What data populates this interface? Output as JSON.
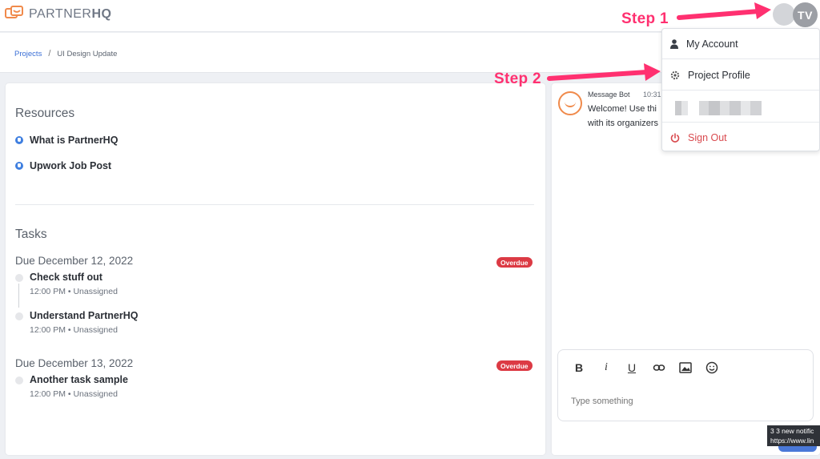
{
  "app": {
    "logo_text": "PARTNERHQ",
    "logo_plain": "PARTNER",
    "logo_bold": "HQ"
  },
  "user": {
    "initials": "TV"
  },
  "breadcrumb": {
    "root": "Projects",
    "separator": "/",
    "current": "UI Design Update"
  },
  "resources": {
    "title": "Resources",
    "items": [
      {
        "label": "What is PartnerHQ"
      },
      {
        "label": "Upwork Job Post"
      }
    ]
  },
  "tasks": {
    "title": "Tasks",
    "groups": [
      {
        "due": "Due December 12, 2022",
        "badge": "Overdue",
        "items": [
          {
            "name": "Check stuff out",
            "meta": "12:00 PM • Unassigned"
          },
          {
            "name": "Understand PartnerHQ",
            "meta": "12:00 PM • Unassigned"
          }
        ]
      },
      {
        "due": "Due December 13, 2022",
        "badge": "Overdue",
        "items": [
          {
            "name": "Another task sample",
            "meta": "12:00 PM • Unassigned"
          }
        ]
      }
    ]
  },
  "chat": {
    "sender": "Message Bot",
    "time": "10:31",
    "message_line1": "Welcome! Use thi",
    "message_line2": "with its organizers",
    "composer": {
      "placeholder": "Type something",
      "tools": [
        "B",
        "i",
        "U"
      ]
    }
  },
  "dropdown": {
    "items": [
      {
        "label": "My Account",
        "icon": "person-icon"
      },
      {
        "label": "Project Profile",
        "icon": "gear-icon"
      },
      {
        "label": "",
        "icon": "blurred-email"
      },
      {
        "label": "Sign Out",
        "icon": "power-icon"
      }
    ]
  },
  "annotations": {
    "step1": "Step 1",
    "step2": "Step 2",
    "color": "#ff3070"
  },
  "tooltip": {
    "line1": "3 3 new notific",
    "line2": "https://www.lin"
  },
  "colors": {
    "accent_blue": "#3a6fd6",
    "danger": "#dc3a44",
    "brand_orange": "#f08a4b"
  }
}
